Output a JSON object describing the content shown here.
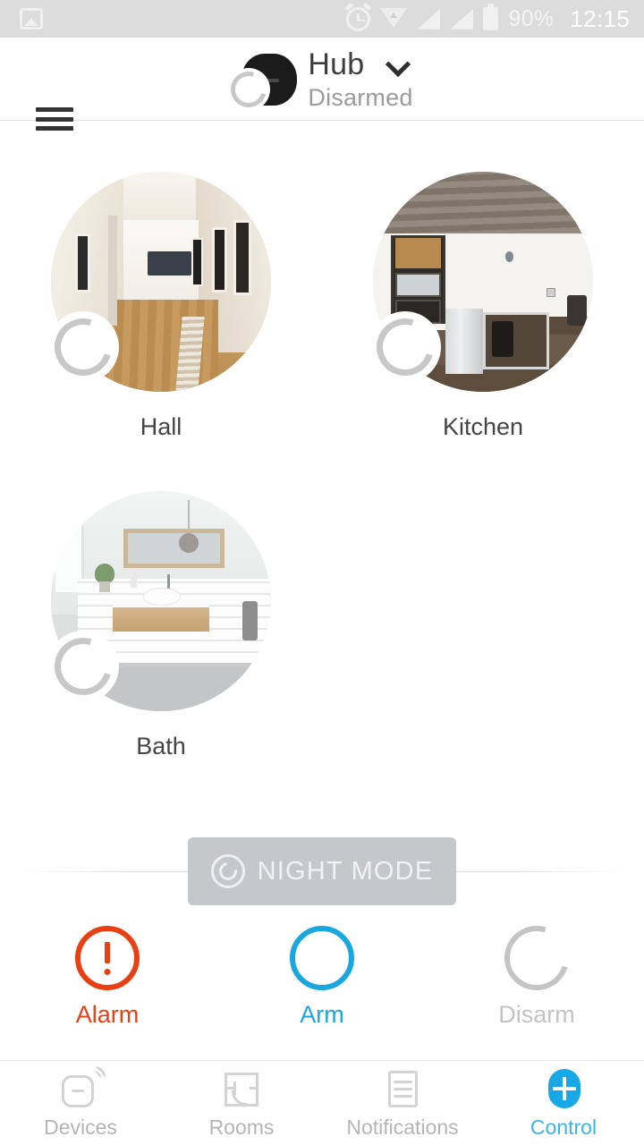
{
  "status_bar": {
    "icons": [
      "image-icon",
      "alarm-clock-icon",
      "wifi-icon",
      "signal-icon",
      "signal-icon",
      "battery-icon"
    ],
    "battery_percent": "90%",
    "time": "12:15"
  },
  "header": {
    "menu_icon": "hamburger-menu-icon",
    "device_icon": "ajax-hub-icon",
    "device_spinner": "loading-spinner-icon",
    "title": "Hub",
    "dropdown_icon": "chevron-down-icon",
    "status": "Disarmed"
  },
  "rooms": [
    {
      "label": "Hall",
      "scene": "hall",
      "spinner": "loading-spinner-icon"
    },
    {
      "label": "Kitchen",
      "scene": "kitchen",
      "spinner": "loading-spinner-icon"
    },
    {
      "label": "Bath",
      "scene": "bath",
      "spinner": "loading-spinner-icon"
    }
  ],
  "night_mode": {
    "label": "NIGHT MODE",
    "icon": "night-mode-icon",
    "background": "#c6c7ca",
    "text_color": "#f2f2f4"
  },
  "actions": [
    {
      "label": "Alarm",
      "icon": "alarm-exclamation-icon",
      "color": "#ea3f12"
    },
    {
      "label": "Arm",
      "icon": "arm-circle-icon",
      "color": "#1aa7e0"
    },
    {
      "label": "Disarm",
      "icon": "disarm-spinner-icon",
      "color": "#c4c4c4"
    }
  ],
  "tabbar": [
    {
      "label": "Devices",
      "icon": "device-signal-icon",
      "active": false
    },
    {
      "label": "Rooms",
      "icon": "floorplan-icon",
      "active": false
    },
    {
      "label": "Notifications",
      "icon": "document-lines-icon",
      "active": false
    },
    {
      "label": "Control",
      "icon": "plus-circle-icon",
      "active": true
    }
  ],
  "colors": {
    "accent": "#17a8e8",
    "alarm": "#ea3f12",
    "inactive": "#b5b5b5",
    "statusbar_bg": "#dcdcdc"
  }
}
